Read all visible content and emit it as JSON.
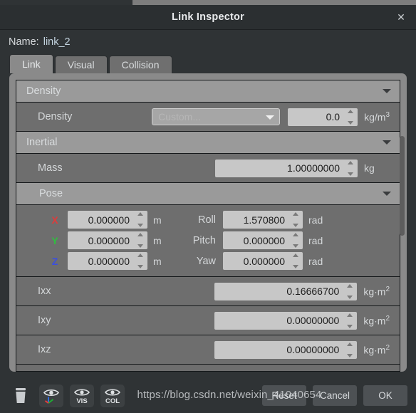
{
  "window": {
    "title": "Link Inspector",
    "close_icon": "close-icon"
  },
  "name_field": {
    "label": "Name:",
    "value": "link_2"
  },
  "tabs": [
    {
      "label": "Link",
      "active": true
    },
    {
      "label": "Visual",
      "active": false
    },
    {
      "label": "Collision",
      "active": false
    }
  ],
  "sections": {
    "density": {
      "header": "Density",
      "row_label": "Density",
      "combo_value": "Custom...",
      "value": "0.0",
      "unit": "kg/m",
      "unit_sup": "3"
    },
    "inertial": {
      "header": "Inertial",
      "mass_label": "Mass",
      "mass_value": "1.00000000",
      "mass_unit": "kg"
    },
    "pose": {
      "header": "Pose",
      "axes": [
        {
          "axis": "X",
          "value": "0.000000",
          "unit": "m",
          "color": "#e03b3b"
        },
        {
          "axis": "Y",
          "value": "0.000000",
          "unit": "m",
          "color": "#2fbf3f"
        },
        {
          "axis": "Z",
          "value": "0.000000",
          "unit": "m",
          "color": "#3b4fe0"
        }
      ],
      "angles": [
        {
          "label": "Roll",
          "value": "1.570800",
          "unit": "rad"
        },
        {
          "label": "Pitch",
          "value": "0.000000",
          "unit": "rad"
        },
        {
          "label": "Yaw",
          "value": "0.000000",
          "unit": "rad"
        }
      ]
    },
    "inertia": [
      {
        "label": "Ixx",
        "value": "0.16666700",
        "unit": "kg·m",
        "unit_sup": "2"
      },
      {
        "label": "Ixy",
        "value": "0.00000000",
        "unit": "kg·m",
        "unit_sup": "2"
      },
      {
        "label": "Ixz",
        "value": "0.00000000",
        "unit": "kg·m",
        "unit_sup": "2"
      }
    ]
  },
  "bottom_toolbar": {
    "icons": [
      {
        "name": "trash-icon",
        "label": ""
      },
      {
        "name": "eye-axes-icon",
        "label": ""
      },
      {
        "name": "eye-visual-icon",
        "label": "VIS"
      },
      {
        "name": "eye-collision-icon",
        "label": "COL"
      }
    ],
    "buttons": [
      {
        "label": "Reset"
      },
      {
        "label": "Cancel"
      },
      {
        "label": "OK"
      }
    ]
  },
  "watermark": {
    "text": "https://blog.csdn.net/weixin_41040654"
  },
  "colors": {
    "dialog_bg": "#2f3335",
    "panel_bg": "#8a8a8a",
    "row_bg": "#6e6e6e",
    "header_bg": "#9a9a9a",
    "field_bg": "#c7c7c7",
    "text": "#d4d7d9"
  }
}
